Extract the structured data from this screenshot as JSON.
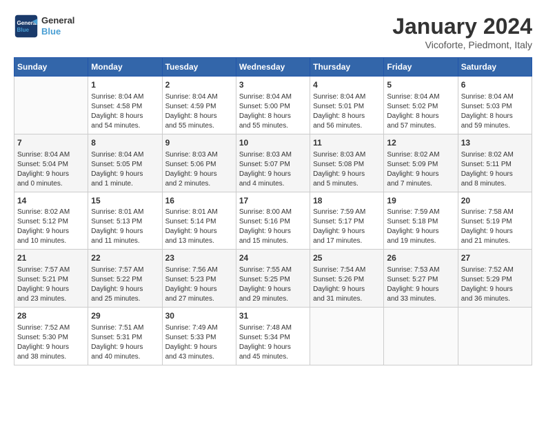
{
  "header": {
    "logo_line1": "General",
    "logo_line2": "Blue",
    "month": "January 2024",
    "location": "Vicoforte, Piedmont, Italy"
  },
  "days_of_week": [
    "Sunday",
    "Monday",
    "Tuesday",
    "Wednesday",
    "Thursday",
    "Friday",
    "Saturday"
  ],
  "weeks": [
    [
      {
        "day": "",
        "info": ""
      },
      {
        "day": "1",
        "info": "Sunrise: 8:04 AM\nSunset: 4:58 PM\nDaylight: 8 hours\nand 54 minutes."
      },
      {
        "day": "2",
        "info": "Sunrise: 8:04 AM\nSunset: 4:59 PM\nDaylight: 8 hours\nand 55 minutes."
      },
      {
        "day": "3",
        "info": "Sunrise: 8:04 AM\nSunset: 5:00 PM\nDaylight: 8 hours\nand 55 minutes."
      },
      {
        "day": "4",
        "info": "Sunrise: 8:04 AM\nSunset: 5:01 PM\nDaylight: 8 hours\nand 56 minutes."
      },
      {
        "day": "5",
        "info": "Sunrise: 8:04 AM\nSunset: 5:02 PM\nDaylight: 8 hours\nand 57 minutes."
      },
      {
        "day": "6",
        "info": "Sunrise: 8:04 AM\nSunset: 5:03 PM\nDaylight: 8 hours\nand 59 minutes."
      }
    ],
    [
      {
        "day": "7",
        "info": "Sunrise: 8:04 AM\nSunset: 5:04 PM\nDaylight: 9 hours\nand 0 minutes."
      },
      {
        "day": "8",
        "info": "Sunrise: 8:04 AM\nSunset: 5:05 PM\nDaylight: 9 hours\nand 1 minute."
      },
      {
        "day": "9",
        "info": "Sunrise: 8:03 AM\nSunset: 5:06 PM\nDaylight: 9 hours\nand 2 minutes."
      },
      {
        "day": "10",
        "info": "Sunrise: 8:03 AM\nSunset: 5:07 PM\nDaylight: 9 hours\nand 4 minutes."
      },
      {
        "day": "11",
        "info": "Sunrise: 8:03 AM\nSunset: 5:08 PM\nDaylight: 9 hours\nand 5 minutes."
      },
      {
        "day": "12",
        "info": "Sunrise: 8:02 AM\nSunset: 5:09 PM\nDaylight: 9 hours\nand 7 minutes."
      },
      {
        "day": "13",
        "info": "Sunrise: 8:02 AM\nSunset: 5:11 PM\nDaylight: 9 hours\nand 8 minutes."
      }
    ],
    [
      {
        "day": "14",
        "info": "Sunrise: 8:02 AM\nSunset: 5:12 PM\nDaylight: 9 hours\nand 10 minutes."
      },
      {
        "day": "15",
        "info": "Sunrise: 8:01 AM\nSunset: 5:13 PM\nDaylight: 9 hours\nand 11 minutes."
      },
      {
        "day": "16",
        "info": "Sunrise: 8:01 AM\nSunset: 5:14 PM\nDaylight: 9 hours\nand 13 minutes."
      },
      {
        "day": "17",
        "info": "Sunrise: 8:00 AM\nSunset: 5:16 PM\nDaylight: 9 hours\nand 15 minutes."
      },
      {
        "day": "18",
        "info": "Sunrise: 7:59 AM\nSunset: 5:17 PM\nDaylight: 9 hours\nand 17 minutes."
      },
      {
        "day": "19",
        "info": "Sunrise: 7:59 AM\nSunset: 5:18 PM\nDaylight: 9 hours\nand 19 minutes."
      },
      {
        "day": "20",
        "info": "Sunrise: 7:58 AM\nSunset: 5:19 PM\nDaylight: 9 hours\nand 21 minutes."
      }
    ],
    [
      {
        "day": "21",
        "info": "Sunrise: 7:57 AM\nSunset: 5:21 PM\nDaylight: 9 hours\nand 23 minutes."
      },
      {
        "day": "22",
        "info": "Sunrise: 7:57 AM\nSunset: 5:22 PM\nDaylight: 9 hours\nand 25 minutes."
      },
      {
        "day": "23",
        "info": "Sunrise: 7:56 AM\nSunset: 5:23 PM\nDaylight: 9 hours\nand 27 minutes."
      },
      {
        "day": "24",
        "info": "Sunrise: 7:55 AM\nSunset: 5:25 PM\nDaylight: 9 hours\nand 29 minutes."
      },
      {
        "day": "25",
        "info": "Sunrise: 7:54 AM\nSunset: 5:26 PM\nDaylight: 9 hours\nand 31 minutes."
      },
      {
        "day": "26",
        "info": "Sunrise: 7:53 AM\nSunset: 5:27 PM\nDaylight: 9 hours\nand 33 minutes."
      },
      {
        "day": "27",
        "info": "Sunrise: 7:52 AM\nSunset: 5:29 PM\nDaylight: 9 hours\nand 36 minutes."
      }
    ],
    [
      {
        "day": "28",
        "info": "Sunrise: 7:52 AM\nSunset: 5:30 PM\nDaylight: 9 hours\nand 38 minutes."
      },
      {
        "day": "29",
        "info": "Sunrise: 7:51 AM\nSunset: 5:31 PM\nDaylight: 9 hours\nand 40 minutes."
      },
      {
        "day": "30",
        "info": "Sunrise: 7:49 AM\nSunset: 5:33 PM\nDaylight: 9 hours\nand 43 minutes."
      },
      {
        "day": "31",
        "info": "Sunrise: 7:48 AM\nSunset: 5:34 PM\nDaylight: 9 hours\nand 45 minutes."
      },
      {
        "day": "",
        "info": ""
      },
      {
        "day": "",
        "info": ""
      },
      {
        "day": "",
        "info": ""
      }
    ]
  ]
}
